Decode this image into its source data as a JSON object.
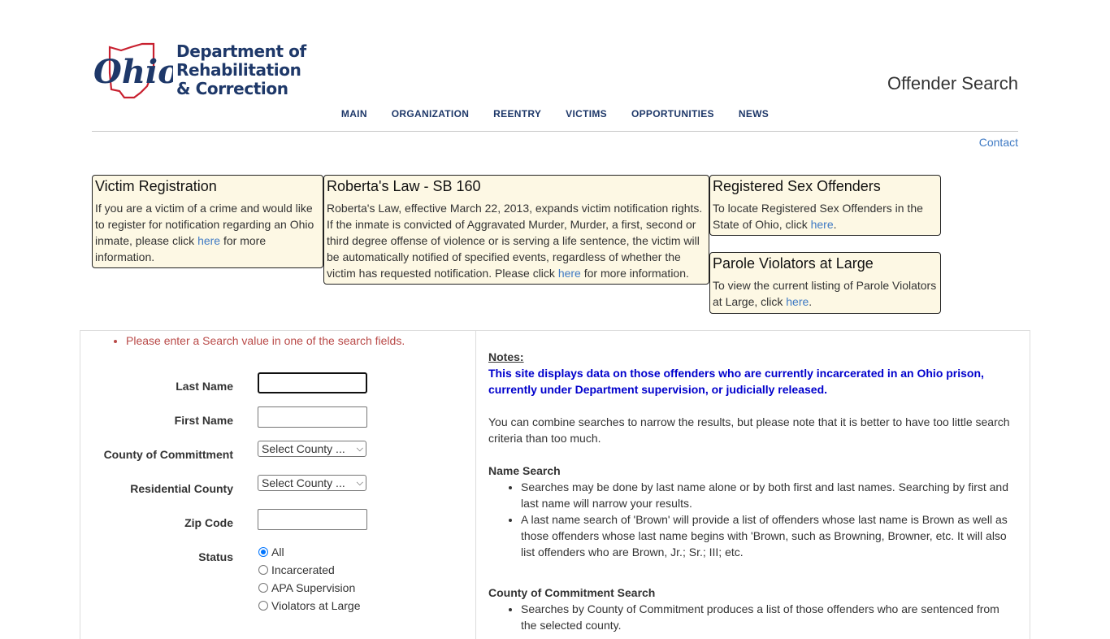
{
  "header": {
    "logo": {
      "script": "Ohio",
      "lines": [
        "Department of",
        "Rehabilitation",
        "& Correction"
      ]
    },
    "page_title": "Offender Search",
    "nav": [
      "MAIN",
      "ORGANIZATION",
      "REENTRY",
      "VICTIMS",
      "OPPORTUNITIES",
      "NEWS"
    ],
    "contact": "Contact"
  },
  "info_boxes": {
    "victim": {
      "title": "Victim Registration",
      "text_before": "If you are a victim of a crime and would like to register for notification regarding an Ohio inmate, please click ",
      "link": "here",
      "text_after": " for more information."
    },
    "roberta": {
      "title": "Roberta's Law - SB 160",
      "text_before": "Roberta's Law, effective March 22, 2013, expands victim notification rights. If the inmate is convicted of Aggravated Murder, Murder, a first, second or third degree offense of violence or is serving a life sentence, the victim will be automatically notified of specified events, regardless of whether the victim has requested notification. Please click ",
      "link": "here",
      "text_after": " for more information."
    },
    "sex_offenders": {
      "title": "Registered Sex Offenders",
      "text_before": "To locate Registered Sex Offenders in the State of Ohio, click ",
      "link": "here",
      "text_after": "."
    },
    "parole": {
      "title": "Parole Violators at Large",
      "text_before": "To view the current listing of Parole Violators at Large, click ",
      "link": "here",
      "text_after": "."
    }
  },
  "search_form": {
    "error": "Please enter a Search value in one of the search fields.",
    "last_name": {
      "label": "Last Name",
      "value": ""
    },
    "first_name": {
      "label": "First Name",
      "value": ""
    },
    "county_commitment": {
      "label": "County of Committment",
      "selected": "Select County ..."
    },
    "residential_county": {
      "label": "Residential County",
      "selected": "Select County ..."
    },
    "zip_code": {
      "label": "Zip Code",
      "value": ""
    },
    "status": {
      "label": "Status",
      "options": [
        "All",
        "Incarcerated",
        "APA Supervision",
        "Violators at Large"
      ],
      "selected": "All"
    }
  },
  "notes": {
    "heading": "Notes:",
    "highlight": "This site displays data on those offenders who are currently incarcerated in an Ohio prison, currently under Department supervision, or judicially released.",
    "combine": "You can combine searches to narrow the results, but please note that it is better to have too little search criteria than too much.",
    "name_search": {
      "title": "Name Search",
      "items": [
        "Searches may be done by last name alone or by both first and last names. Searching by first and last name will narrow your results.",
        "A last name search of 'Brown' will provide a list of offenders whose last name is Brown as well as those offenders whose last name begins with 'Brown, such as Browning, Browner, etc. It will also list offenders who are Brown, Jr.; Sr.; III; etc."
      ]
    },
    "county_search": {
      "title": "County of Commitment Search",
      "items": [
        "Searches by County of Commitment produces a list of those offenders who are sentenced from the selected county."
      ]
    }
  }
}
